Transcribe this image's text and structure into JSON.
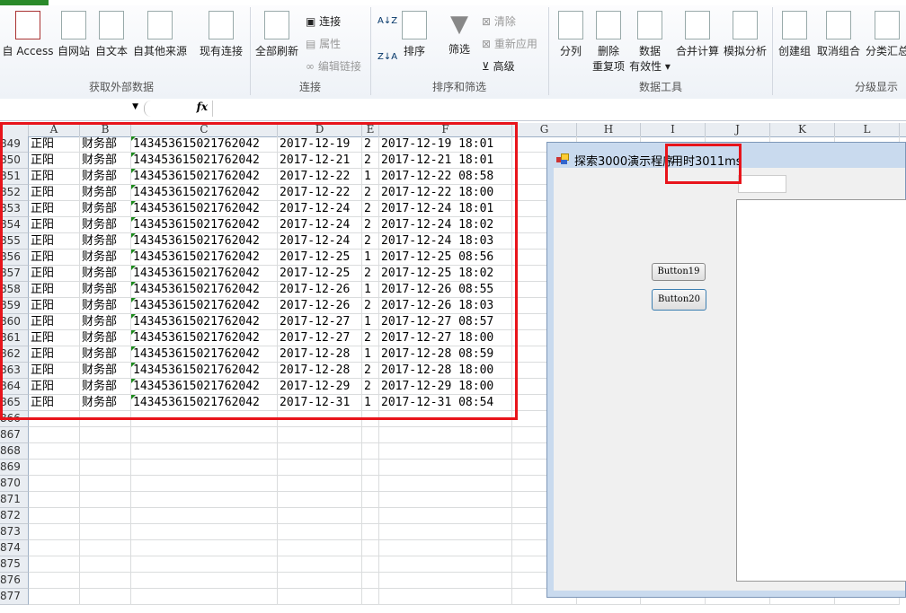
{
  "ribbon": {
    "ext": {
      "access": "自 Access",
      "web": "自网站",
      "text": "自文本",
      "other": "自其他来源",
      "existing": "现有连接",
      "group": "获取外部数据"
    },
    "conn": {
      "refresh": "全部刷新",
      "connections": "连接",
      "properties": "属性",
      "edit_links": "编辑链接",
      "group": "连接"
    },
    "sort": {
      "sort": "排序",
      "filter": "筛选",
      "clear": "清除",
      "reapply": "重新应用",
      "advanced": "高级",
      "group": "排序和筛选"
    },
    "tools": {
      "split": "分列",
      "remove1": "删除",
      "remove2": "重复项",
      "valid1": "数据",
      "valid2": "有效性",
      "consolidate": "合并计算",
      "whatif": "模拟分析",
      "group": "数据工具"
    },
    "outline": {
      "group_btn": "创建组",
      "ungroup": "取消组合",
      "subtotal": "分类汇总",
      "group": "分级显示"
    }
  },
  "formula_bar": {
    "fx": "fx",
    "value": ""
  },
  "columns": [
    "A",
    "B",
    "C",
    "D",
    "E",
    "F",
    "G",
    "H",
    "I",
    "J",
    "K",
    "L"
  ],
  "rows": [
    [
      "849",
      "正阳",
      "财务部",
      "143453615021762042",
      "2017-12-19",
      "2",
      "2017-12-19 18:01"
    ],
    [
      "850",
      "正阳",
      "财务部",
      "143453615021762042",
      "2017-12-21",
      "2",
      "2017-12-21 18:01"
    ],
    [
      "851",
      "正阳",
      "财务部",
      "143453615021762042",
      "2017-12-22",
      "1",
      "2017-12-22 08:58"
    ],
    [
      "852",
      "正阳",
      "财务部",
      "143453615021762042",
      "2017-12-22",
      "2",
      "2017-12-22 18:00"
    ],
    [
      "853",
      "正阳",
      "财务部",
      "143453615021762042",
      "2017-12-24",
      "2",
      "2017-12-24 18:01"
    ],
    [
      "854",
      "正阳",
      "财务部",
      "143453615021762042",
      "2017-12-24",
      "2",
      "2017-12-24 18:02"
    ],
    [
      "855",
      "正阳",
      "财务部",
      "143453615021762042",
      "2017-12-24",
      "2",
      "2017-12-24 18:03"
    ],
    [
      "856",
      "正阳",
      "财务部",
      "143453615021762042",
      "2017-12-25",
      "1",
      "2017-12-25 08:56"
    ],
    [
      "857",
      "正阳",
      "财务部",
      "143453615021762042",
      "2017-12-25",
      "2",
      "2017-12-25 18:02"
    ],
    [
      "858",
      "正阳",
      "财务部",
      "143453615021762042",
      "2017-12-26",
      "1",
      "2017-12-26 08:55"
    ],
    [
      "859",
      "正阳",
      "财务部",
      "143453615021762042",
      "2017-12-26",
      "2",
      "2017-12-26 18:03"
    ],
    [
      "860",
      "正阳",
      "财务部",
      "143453615021762042",
      "2017-12-27",
      "1",
      "2017-12-27 08:57"
    ],
    [
      "861",
      "正阳",
      "财务部",
      "143453615021762042",
      "2017-12-27",
      "2",
      "2017-12-27 18:00"
    ],
    [
      "862",
      "正阳",
      "财务部",
      "143453615021762042",
      "2017-12-28",
      "1",
      "2017-12-28 08:59"
    ],
    [
      "863",
      "正阳",
      "财务部",
      "143453615021762042",
      "2017-12-28",
      "2",
      "2017-12-28 18:00"
    ],
    [
      "864",
      "正阳",
      "财务部",
      "143453615021762042",
      "2017-12-29",
      "2",
      "2017-12-29 18:00"
    ],
    [
      "865",
      "正阳",
      "财务部",
      "143453615021762042",
      "2017-12-31",
      "1",
      "2017-12-31 08:54"
    ]
  ],
  "empty_rows": [
    "866",
    "867",
    "868",
    "869",
    "870",
    "871",
    "872",
    "873",
    "874",
    "875",
    "876",
    "877"
  ],
  "dialog": {
    "title": "探索3000演示程序",
    "elapsed": "用时3011ms",
    "button19": "Button19",
    "button20": "Button20",
    "input_value": ""
  },
  "colors": {
    "highlight": "#e8141b",
    "accent": "#2a8a2a"
  }
}
